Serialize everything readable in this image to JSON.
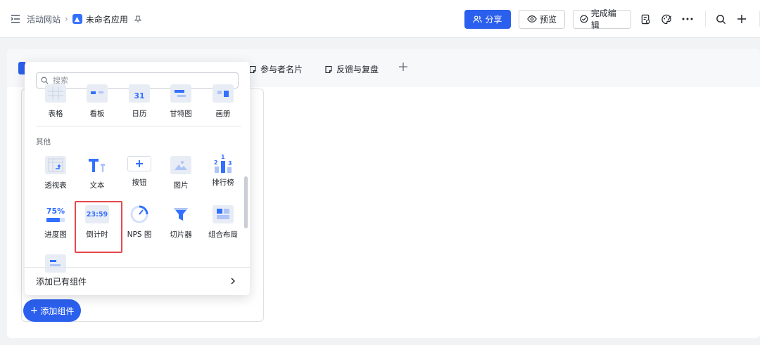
{
  "topbar": {
    "breadcrumb_parent": "活动网站",
    "app_name": "未命名应用",
    "share_label": "分享",
    "preview_label": "预览",
    "done_label": "完成编辑"
  },
  "tabs": [
    {
      "label": "参与者名片"
    },
    {
      "label": "反馈与复盘"
    }
  ],
  "panel": {
    "search_placeholder": "搜索",
    "top_row": [
      {
        "label": "表格"
      },
      {
        "label": "看板"
      },
      {
        "label": "日历",
        "icon_text": "31"
      },
      {
        "label": "甘特图"
      },
      {
        "label": "画册"
      }
    ],
    "section_other": "其他",
    "other_row1": [
      {
        "label": "透视表"
      },
      {
        "label": "文本"
      },
      {
        "label": "按钮"
      },
      {
        "label": "图片"
      },
      {
        "label": "排行榜",
        "icon_digits": [
          "2",
          "1",
          "3"
        ]
      }
    ],
    "other_row2": [
      {
        "label": "进度图",
        "icon_text": "75%"
      },
      {
        "label": "倒计时",
        "icon_text": "23:59"
      },
      {
        "label": "NPS 图"
      },
      {
        "label": "切片器"
      },
      {
        "label": "组合布局"
      }
    ],
    "footer_label": "添加已有组件"
  },
  "add_component_label": "添加组件",
  "colors": {
    "primary": "#2b5fed",
    "highlight": "#e5484d",
    "icon_blue": "#3370ff"
  }
}
